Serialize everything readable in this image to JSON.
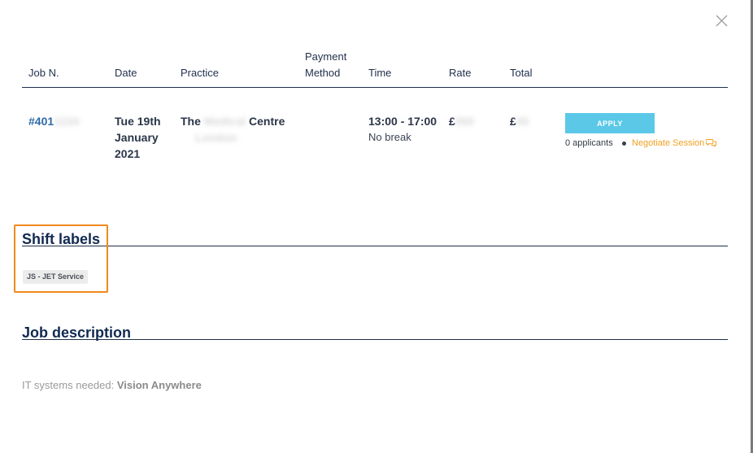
{
  "table": {
    "headers": {
      "job_no": "Job N.",
      "date": "Date",
      "practice": "Practice",
      "payment_line1": "Payment",
      "payment_line2": "Method",
      "time": "Time",
      "rate": "Rate",
      "total": "Total"
    },
    "row": {
      "job_no": "#401",
      "date_line1": "Tue 19th",
      "date_line2": "January",
      "date_line3": "2021",
      "practice_prefix": "The",
      "practice_suffix": "Centre",
      "payment_method": "",
      "time": "13:00 - 17:00",
      "break": "No break",
      "rate_prefix": "£",
      "total_prefix": "£"
    }
  },
  "actions": {
    "apply_label": "APPLY",
    "applicants": "0 applicants",
    "negotiate_label": "Negotiate Session"
  },
  "shift_labels": {
    "title": "Shift labels",
    "tags": [
      "JS - JET Service"
    ]
  },
  "job_description": {
    "title": "Job description",
    "it_label": "IT systems needed:",
    "it_value": "Vision Anywhere"
  },
  "colors": {
    "apply_button": "#5bc8e8",
    "negotiate_link": "#f0a020",
    "highlight_box": "#f08a1c",
    "job_link": "#2e6aa8"
  },
  "icons": {
    "close": "close-icon",
    "negotiate": "chat-bubbles-icon"
  }
}
